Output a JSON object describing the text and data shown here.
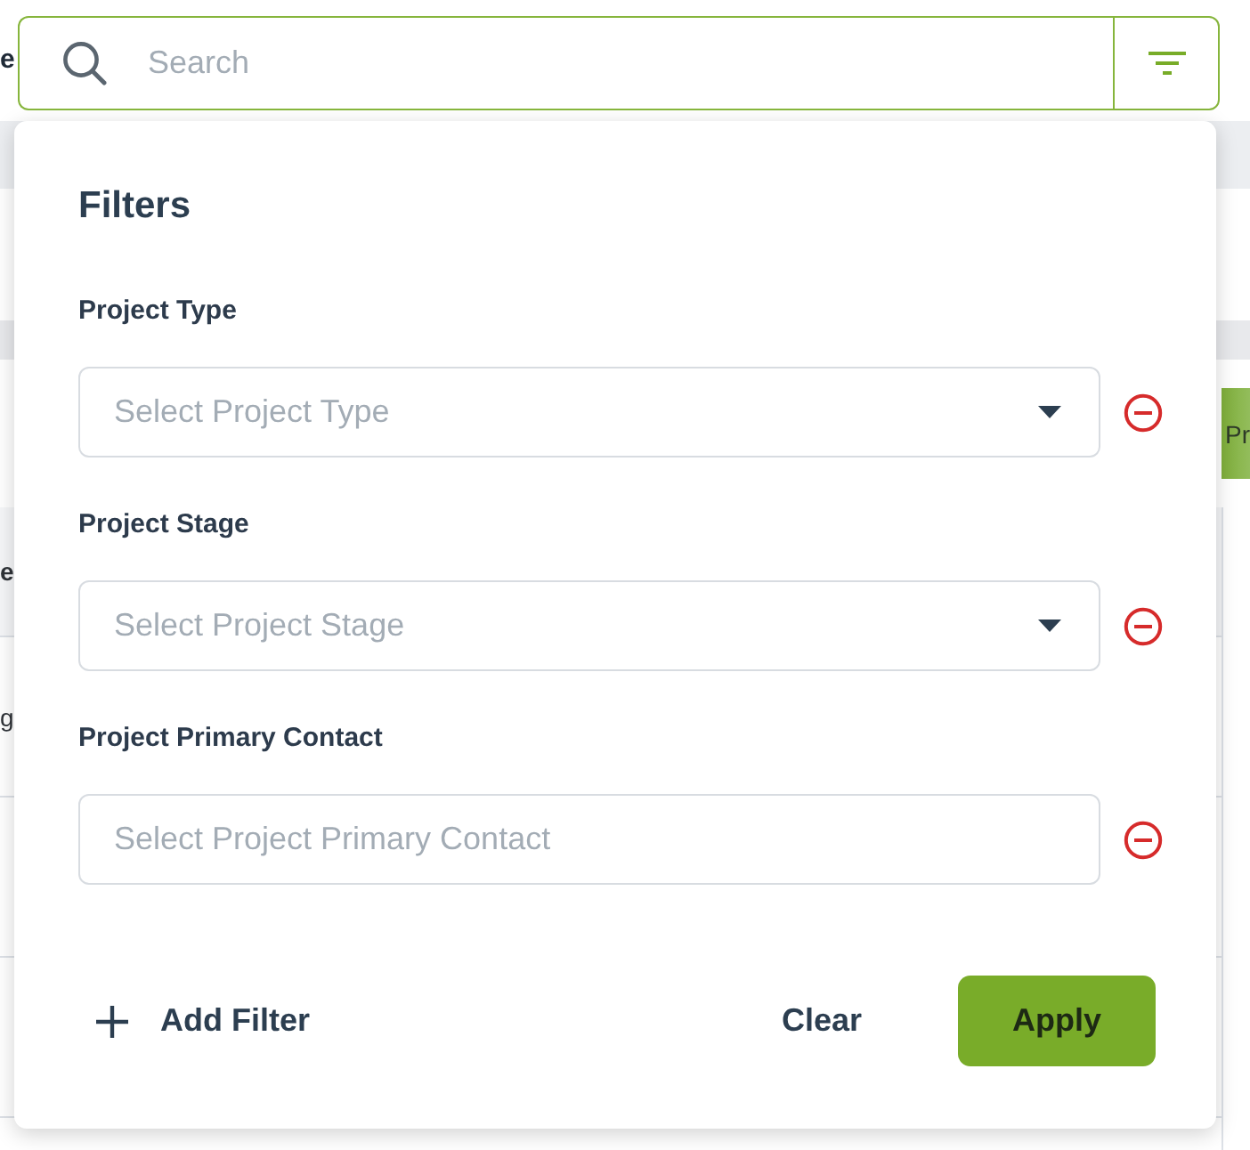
{
  "background_page": {
    "title_fragment": "e",
    "button_fragment": "Pr",
    "table_header_fragment": "e",
    "rows": [
      {
        "cell": "g"
      }
    ]
  },
  "search": {
    "placeholder": "Search"
  },
  "filter_panel": {
    "title": "Filters",
    "filters": [
      {
        "label": "Project Type",
        "kind": "dropdown",
        "placeholder": "Select Project Type"
      },
      {
        "label": "Project Stage",
        "kind": "dropdown",
        "placeholder": "Select Project Stage"
      },
      {
        "label": "Project Primary Contact",
        "kind": "text",
        "placeholder": "Select Project Primary Contact"
      }
    ],
    "add_filter": "Add Filter",
    "clear": "Clear",
    "apply": "Apply"
  }
}
